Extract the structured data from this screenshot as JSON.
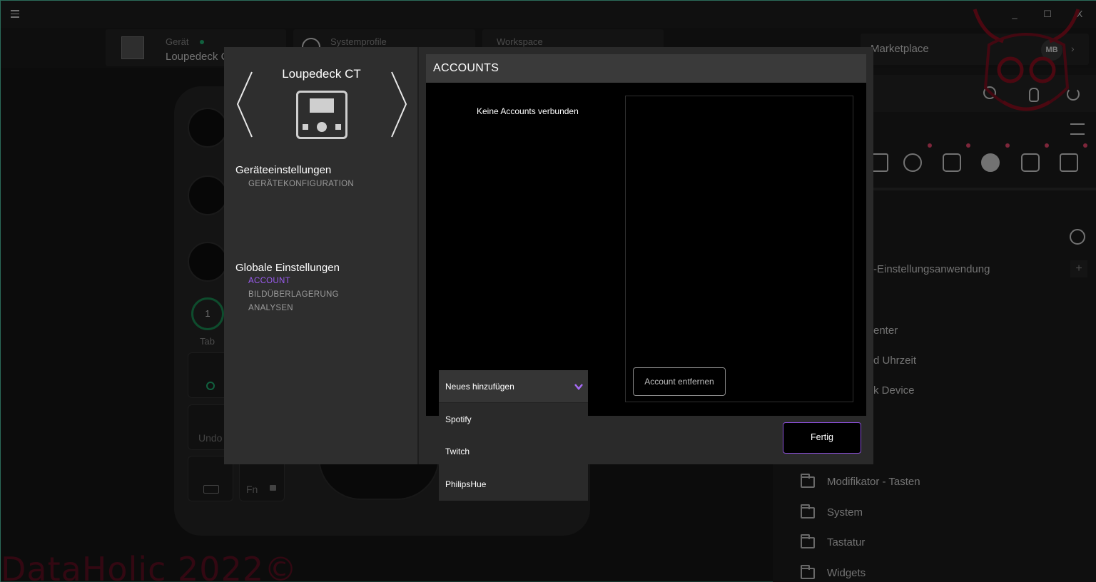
{
  "titlebar": {
    "minimize": "_",
    "maximize": "☐",
    "close": "X"
  },
  "top": {
    "device_label": "Gerät",
    "device_value": "Loupedeck CT",
    "profiles_label": "Systemprofile",
    "workspace_label": "Workspace",
    "marketplace": "Marketplace",
    "avatar": "MB"
  },
  "device_bg": {
    "ring_label": "1",
    "tab_label": "Tab",
    "undo_label": "Undo",
    "fn_label": "Fn"
  },
  "right_panel": {
    "items": [
      "-Einstellungsanwendung",
      "enter",
      "d Uhrzeit",
      "k Device"
    ],
    "folders": [
      "Modifikator - Tasten",
      "System",
      "Tastatur",
      "Widgets"
    ],
    "plus": "+"
  },
  "watermark": "DataHolic 2022©",
  "dialog": {
    "device_title": "Loupedeck CT",
    "device_settings_heading": "Geräteeinstellungen",
    "device_settings_items": [
      "GERÄTEKONFIGURATION"
    ],
    "global_settings_heading": "Globale Einstellungen",
    "global_settings_items": [
      "ACCOUNT",
      "BILDÜBERLAGERUNG",
      "ANALYSEN"
    ],
    "active_item": "ACCOUNT",
    "header": "ACCOUNTS",
    "no_accounts": "Keine Accounts verbunden",
    "remove_button": "Account entfernen",
    "select_value": "Neues hinzufügen",
    "options": [
      "Spotify",
      "Twitch",
      "PhilipsHue"
    ],
    "done_button": "Fertig"
  },
  "colors": {
    "accent": "#9b5cf0",
    "green": "#1a8a52",
    "notification": "#e3456a"
  }
}
